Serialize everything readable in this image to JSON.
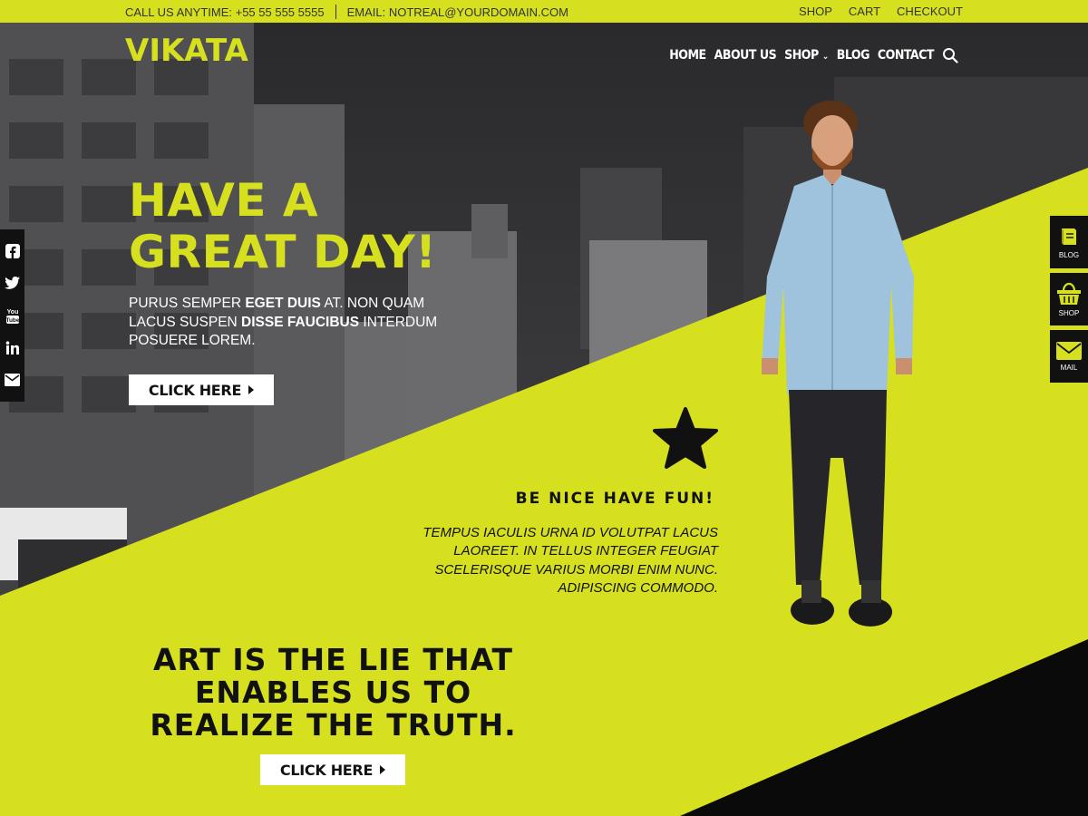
{
  "topbar": {
    "phone": "CALL US ANYTIME: +55 55 555 5555",
    "email": "EMAIL: NOTREAL@YOURDOMAIN.COM",
    "links": [
      "SHOP",
      "CART",
      "CHECKOUT"
    ]
  },
  "header": {
    "logo": "VIKATA",
    "nav": [
      "HOME",
      "ABOUT US",
      "SHOP",
      "BLOG",
      "CONTACT"
    ]
  },
  "hero": {
    "headline_line1": "HAVE A",
    "headline_line2": "GREAT DAY!",
    "intro_parts": [
      "PURUS SEMPER ",
      "EGET DUIS",
      " AT. NON QUAM LACUS SUSPEN ",
      "DISSE FAUCIBUS",
      " INTERDUM POSUERE LOREM."
    ],
    "button_label": "CLICK HERE"
  },
  "social": {
    "icons": [
      "facebook-icon",
      "twitter-icon",
      "youtube-icon",
      "linkedin-icon",
      "mail-icon"
    ],
    "youtube_text": "You Tube"
  },
  "right_menu": [
    {
      "label": "BLOG",
      "icon": "book-icon"
    },
    {
      "label": "SHOP",
      "icon": "basket-icon"
    },
    {
      "label": "MAIL",
      "icon": "envelope-icon"
    }
  ],
  "feature": {
    "icon": "star-icon",
    "title": "BE NICE HAVE FUN!",
    "text": "TEMPUS IACULIS URNA ID VOLUTPAT LACUS LAOREET. IN TELLUS INTEGER FEUGIAT SCELERISQUE VARIUS MORBI ENIM NUNC. ADIPISCING COMMODO."
  },
  "quote": {
    "text": "ART IS THE LIE THAT ENABLES US TO REALIZE THE TRUTH.",
    "button_label": "CLICK HERE"
  },
  "colors": {
    "accent": "#d6e01e",
    "dark": "#111111",
    "photo": "#3a3a3c"
  }
}
